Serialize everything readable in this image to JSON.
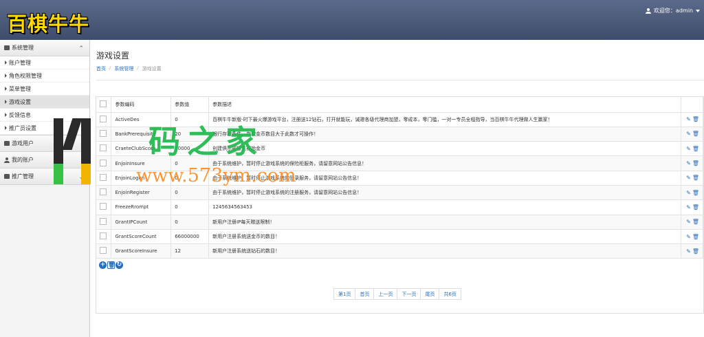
{
  "header": {
    "logo": "百棋牛牛",
    "welcome": "欢迎您：admin"
  },
  "sidebar": {
    "groups": [
      {
        "label": "系统管理",
        "expanded": true
      },
      {
        "label": "游戏用户"
      },
      {
        "label": "我的账户"
      },
      {
        "label": "推广管理"
      }
    ],
    "items": [
      {
        "label": "账户管理"
      },
      {
        "label": "角色权限管理"
      },
      {
        "label": "菜单管理"
      },
      {
        "label": "游戏设置",
        "active": true
      },
      {
        "label": "反馈信息"
      },
      {
        "label": "推广员设置"
      }
    ]
  },
  "page": {
    "title": "游戏设置",
    "breadcrumb": [
      "首页",
      "系统管理",
      "游戏设置"
    ],
    "breadcrumb_sep": "/"
  },
  "table": {
    "headers": [
      "参数编码",
      "参数值",
      "参数描述"
    ],
    "rows": [
      {
        "code": "ActiveDes",
        "value": "0",
        "desc": "百棋牛牛新版-时下最火爆游戏平台，注册送12钻石，打开就能玩，诚邀各级代理商加盟，零成本，零门槛，一对一专员全程指导，当百棋牛牛代理做人生赢家！"
      },
      {
        "code": "BankPrerequisite",
        "value": "20",
        "desc": "银行存取条件，存取金币数目大于此数才可操作！"
      },
      {
        "code": "CraeteClubScore",
        "value": "10000",
        "desc": "创建俱乐部楼主初始金币"
      },
      {
        "code": "EnjoinInsure",
        "value": "0",
        "desc": "由于系统维护，暂时停止游戏系统的保险柜服务，请留意网站公告信息！"
      },
      {
        "code": "EnjoinLogon",
        "value": "0",
        "desc": "由于系统维护，暂时停止游戏系统的登录服务，请留意网站公告信息！"
      },
      {
        "code": "EnjoinRegister",
        "value": "0",
        "desc": "由于系统维护，暂时停止游戏系统的注册服务，请留意网站公告信息！"
      },
      {
        "code": "FreezeRrompt",
        "value": "0",
        "desc": "1245634563453"
      },
      {
        "code": "GrantIPCount",
        "value": "0",
        "desc": "新用户注册IP每天赠送限制！"
      },
      {
        "code": "GrantScoreCount",
        "value": "66000000",
        "desc": "新用户注册系统送金币的数目！"
      },
      {
        "code": "GrantScoreInsure",
        "value": "12",
        "desc": "新用户注册系统送钻石的数目！"
      }
    ],
    "row_actions": [
      "edit-icon",
      "delete-icon"
    ],
    "tools": [
      "add-icon",
      "delete-icon",
      "refresh-icon"
    ]
  },
  "pager": {
    "buttons": [
      "第1页",
      "首页",
      "上一页",
      "下一页",
      "尾页",
      "共6页"
    ]
  },
  "watermark": {
    "title": "码之家",
    "url": "www.573ym.com"
  }
}
